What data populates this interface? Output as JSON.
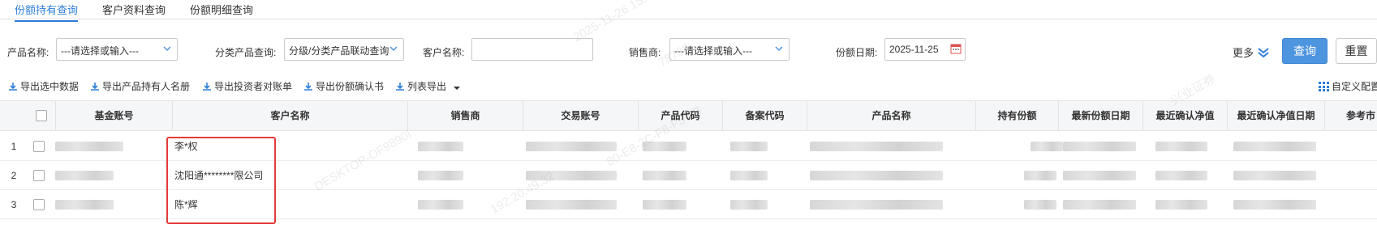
{
  "tabs": [
    {
      "label": "份额持有查询",
      "active": true
    },
    {
      "label": "客户资料查询",
      "active": false
    },
    {
      "label": "份额明细查询",
      "active": false
    }
  ],
  "filters": {
    "product_label": "产品名称:",
    "product_placeholder": "---请选择或输入---",
    "category_label": "分类产品查询:",
    "category_value": "分级/分类产品联动查询",
    "customer_label": "客户名称:",
    "customer_value": "",
    "seller_label": "销售商:",
    "seller_placeholder": "---请选择或输入---",
    "date_label": "份额日期:",
    "date_value": "2025-11-25",
    "more_label": "更多",
    "query_button": "查询",
    "reset_button": "重置"
  },
  "toolbar": {
    "export_selected": "导出选中数据",
    "export_holders": "导出产品持有人名册",
    "export_statement": "导出投资者对账单",
    "export_confirm": "导出份额确认书",
    "export_list": "列表导出",
    "custom_config": "自定义配置"
  },
  "table": {
    "columns": [
      "基金账号",
      "客户名称",
      "销售商",
      "交易账号",
      "产品代码",
      "备案代码",
      "产品名称",
      "持有份额",
      "最新份额日期",
      "最近确认净值",
      "最近确认净值日期",
      "参考市"
    ],
    "rows": [
      {
        "num": "1",
        "customer": "李*权"
      },
      {
        "num": "2",
        "customer": "沈阳通********限公司"
      },
      {
        "num": "3",
        "customer": "陈*辉"
      }
    ]
  },
  "watermark": {
    "company": "兴业证券",
    "datetime": "2025-11-26 15:56",
    "ip": "192.20.49.32",
    "mac": "80-E8-2C-F8-F5-8B",
    "host": "DESKTOP-OF9890I",
    "id": "78738"
  },
  "colors": {
    "accent": "#2f7ed8",
    "primary_button": "#4e95e0",
    "highlight": "#e43b3b"
  }
}
